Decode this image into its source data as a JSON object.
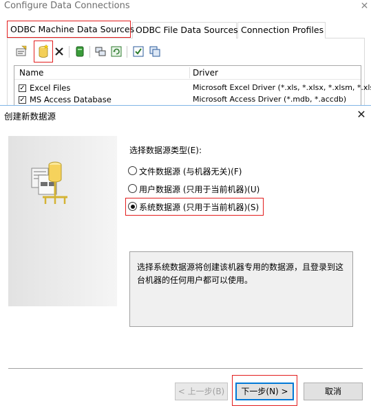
{
  "back_window": {
    "title": "Configure Data Connections",
    "close_glyph": "✕",
    "tabs": [
      {
        "label": "ODBC Machine Data Sources",
        "active": true
      },
      {
        "label": "ODBC File Data Sources",
        "active": false
      },
      {
        "label": "Connection Profiles",
        "active": false
      }
    ],
    "toolbar_icons": [
      "properties-icon",
      "add-data-source-icon",
      "delete-icon",
      "database-icon",
      "connect-icon",
      "refresh-icon",
      "select-all-icon",
      "copy-icon"
    ],
    "list": {
      "headers": [
        "Name",
        "Driver"
      ],
      "rows": [
        {
          "checked": true,
          "name": "Excel Files",
          "driver": "Microsoft Excel Driver (*.xls, *.xlsx, *.xlsm, *.xlsb)"
        },
        {
          "checked": true,
          "name": "MS Access Database",
          "driver": "Microsoft Access Driver (*.mdb, *.accdb)"
        }
      ]
    }
  },
  "dialog": {
    "title": "创建新数据源",
    "close_glyph": "✕",
    "prompt": "选择数据源类型(E):",
    "options": [
      {
        "label": "文件数据源 (与机器无关)(F)",
        "selected": false
      },
      {
        "label": "用户数据源 (只用于当前机器)(U)",
        "selected": false
      },
      {
        "label": "系统数据源 (只用于当前机器)(S)",
        "selected": true
      }
    ],
    "description": "选择系统数据源将创建该机器专用的数据源，且登录到这台机器的任何用户都可以使用。",
    "buttons": {
      "back": "< 上一步(B)",
      "next": "下一步(N) >",
      "cancel": "取消"
    },
    "side_icon": "data-source-wizard-icon"
  },
  "colors": {
    "highlight": "#e21b1b",
    "focus_blue": "#0078d7"
  }
}
